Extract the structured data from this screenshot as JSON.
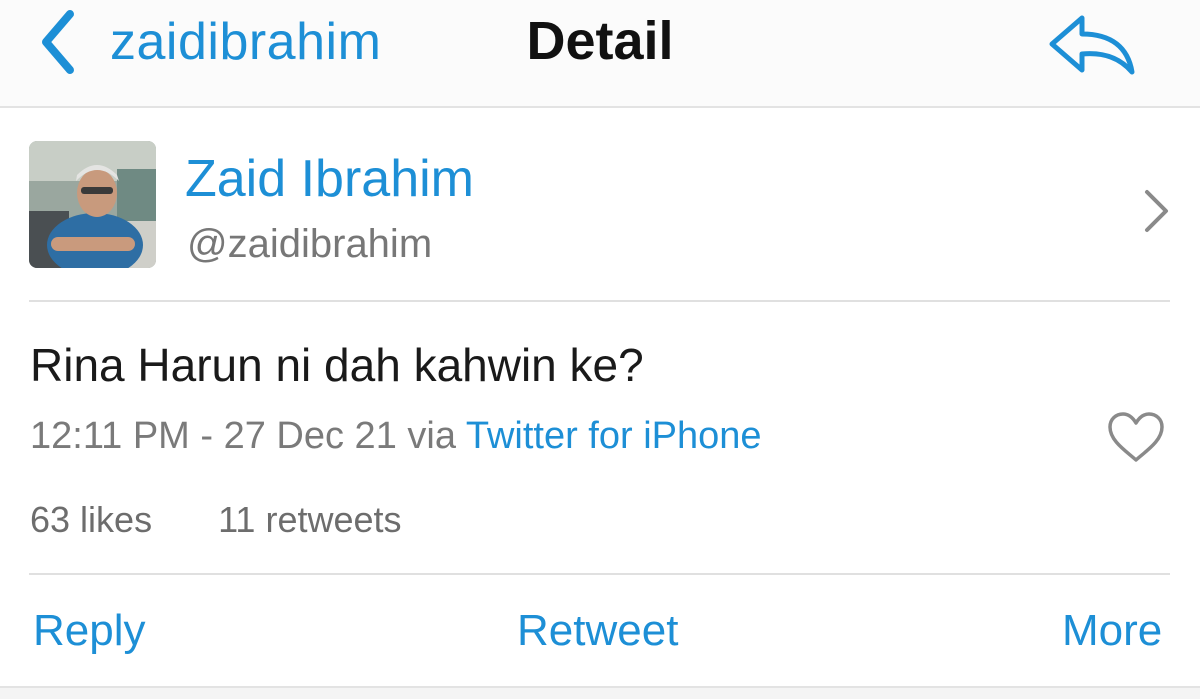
{
  "navbar": {
    "back_label": "zaidibrahim",
    "title": "Detail",
    "accent_color": "#1d8fd6",
    "back_icon": "chevron-left-icon",
    "reply_icon": "reply-arrow-icon"
  },
  "profile": {
    "name": "Zaid Ibrahim",
    "handle": "@zaidibrahim",
    "avatar": "avatar-photo",
    "disclosure_icon": "chevron-right-icon"
  },
  "tweet": {
    "text": "Rina Harun ni dah kahwin ke?",
    "timestamp": "12:11 PM - 27 Dec 21",
    "via_label": "via",
    "source": "Twitter for iPhone",
    "like_icon": "heart-outline-icon"
  },
  "stats": {
    "likes": "63 likes",
    "retweets": "11 retweets"
  },
  "actions": {
    "reply": "Reply",
    "retweet": "Retweet",
    "more": "More"
  }
}
